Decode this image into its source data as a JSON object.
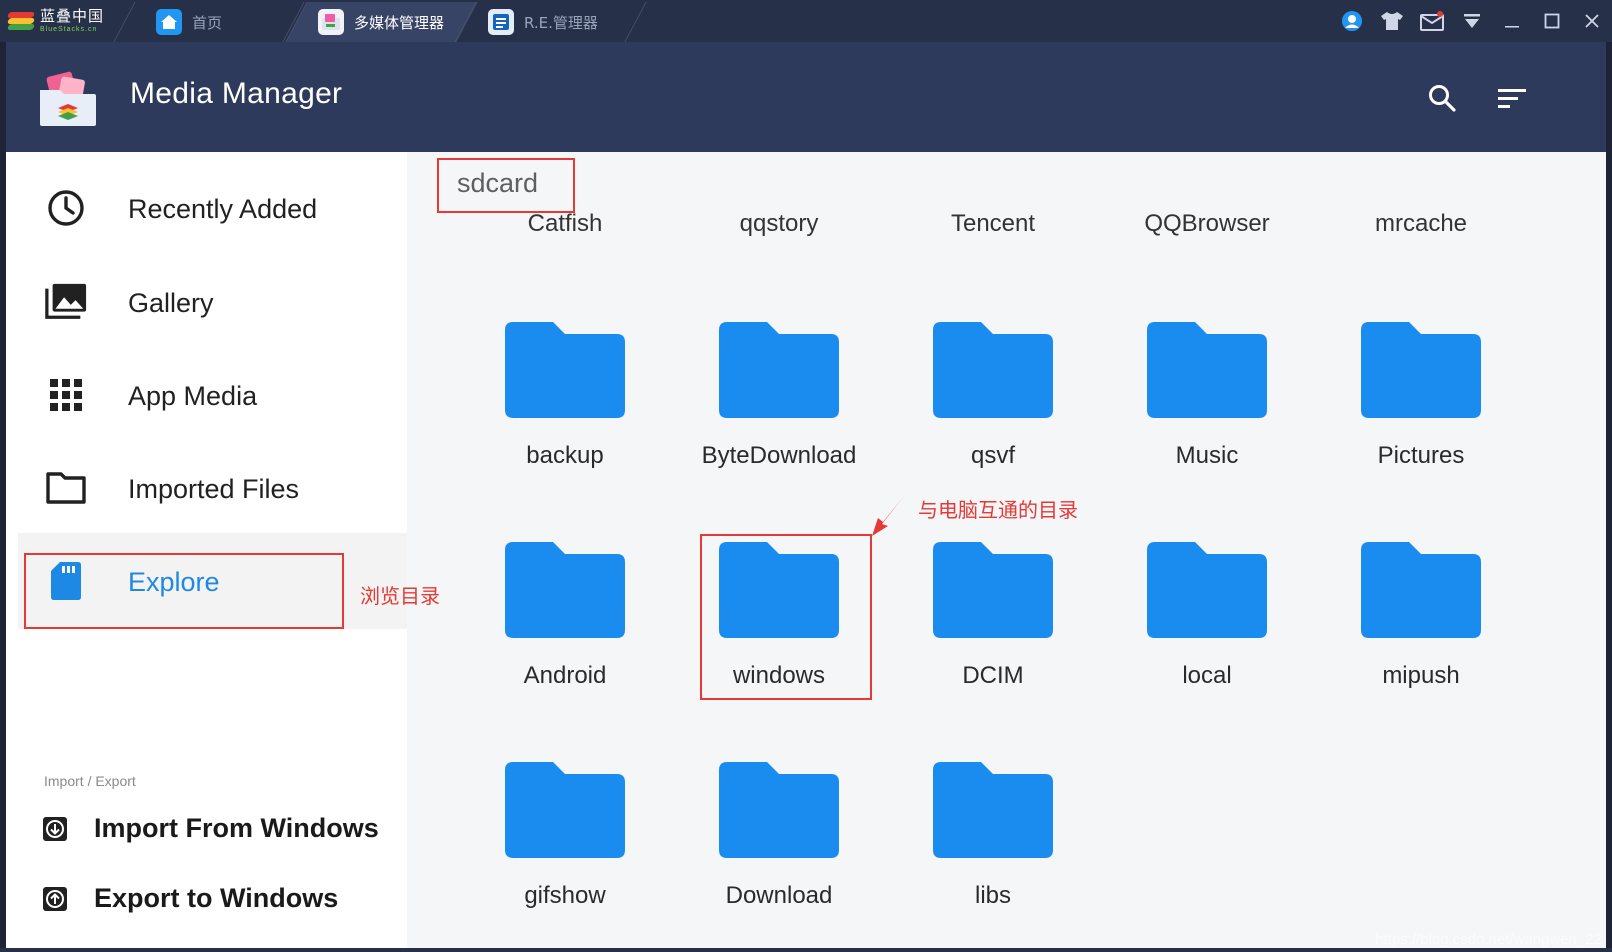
{
  "titlebar": {
    "brand_cn": "蓝叠中国",
    "brand_en": "BlueStacks.cn",
    "tabs": [
      {
        "label": "首页",
        "active": false
      },
      {
        "label": "多媒体管理器",
        "active": true
      },
      {
        "label": "R.E.管理器",
        "active": false
      }
    ]
  },
  "app": {
    "title": "Media Manager"
  },
  "sidebar": {
    "items": [
      {
        "label": "Recently Added"
      },
      {
        "label": "Gallery"
      },
      {
        "label": "App Media"
      },
      {
        "label": "Imported Files"
      },
      {
        "label": "Explore",
        "active": true
      }
    ],
    "section_label": "Import / Export",
    "actions": [
      {
        "label": "Import From Windows"
      },
      {
        "label": "Export to Windows"
      }
    ]
  },
  "content": {
    "path": "sdcard",
    "cut_off_row": [
      "Catfish",
      "qqstory",
      "Tencent",
      "QQBrowser",
      "mrcache"
    ],
    "folders": [
      {
        "name": "backup"
      },
      {
        "name": "ByteDownload"
      },
      {
        "name": "qsvf"
      },
      {
        "name": "Music"
      },
      {
        "name": "Pictures"
      },
      {
        "name": "Android"
      },
      {
        "name": "windows"
      },
      {
        "name": "DCIM"
      },
      {
        "name": "local"
      },
      {
        "name": "mipush"
      },
      {
        "name": "gifshow"
      },
      {
        "name": "Download"
      },
      {
        "name": "libs"
      }
    ]
  },
  "annotations": {
    "explore_note": "浏览目录",
    "windows_note": "与电脑互通的目录"
  },
  "watermark": "https://blog.csdn.net/wangwen_22",
  "colors": {
    "titlebar": "#263049",
    "header": "#2e3a5c",
    "accent": "#1e88e5",
    "folder": "#1a8cf0",
    "annotation": "#e53935"
  }
}
